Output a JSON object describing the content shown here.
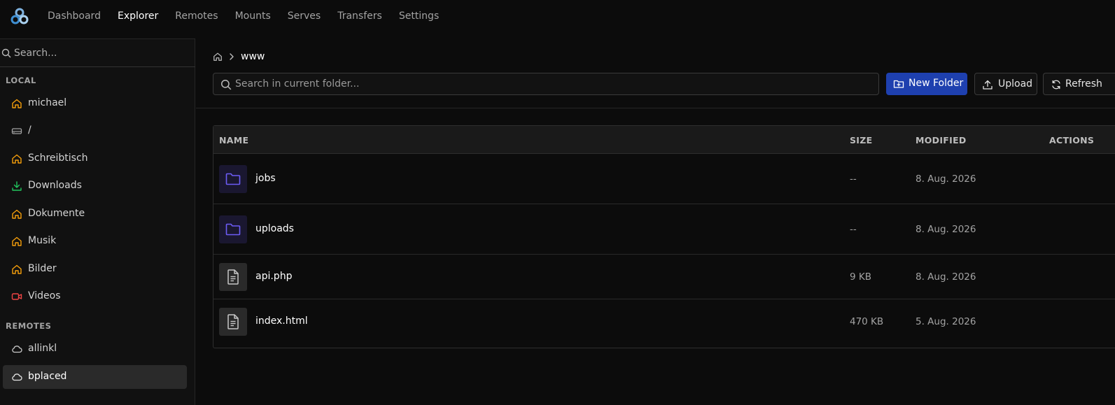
{
  "nav": {
    "items": [
      {
        "label": "Dashboard",
        "active": false
      },
      {
        "label": "Explorer",
        "active": true
      },
      {
        "label": "Remotes",
        "active": false
      },
      {
        "label": "Mounts",
        "active": false
      },
      {
        "label": "Serves",
        "active": false
      },
      {
        "label": "Transfers",
        "active": false
      },
      {
        "label": "Settings",
        "active": false
      }
    ]
  },
  "sidebar": {
    "search_placeholder": "Search...",
    "local_label": "LOCAL",
    "local_items": [
      {
        "label": "michael",
        "icon": "home-icon"
      },
      {
        "label": "/",
        "icon": "drive-icon"
      },
      {
        "label": "Schreibtisch",
        "icon": "home-icon"
      },
      {
        "label": "Downloads",
        "icon": "download-icon"
      },
      {
        "label": "Dokumente",
        "icon": "home-icon"
      },
      {
        "label": "Musik",
        "icon": "home-icon"
      },
      {
        "label": "Bilder",
        "icon": "home-icon"
      },
      {
        "label": "Videos",
        "icon": "video-icon"
      }
    ],
    "remotes_label": "REMOTES",
    "remote_items": [
      {
        "label": "allinkl",
        "icon": "cloud-icon",
        "selected": false
      },
      {
        "label": "bplaced",
        "icon": "cloud-icon",
        "selected": true
      }
    ]
  },
  "breadcrumb": {
    "current": "www"
  },
  "toolbar": {
    "search_placeholder": "Search in current folder...",
    "new_folder_label": "New Folder",
    "upload_label": "Upload",
    "refresh_label": "Refresh"
  },
  "table": {
    "headers": {
      "name": "NAME",
      "size": "SIZE",
      "modified": "MODIFIED",
      "actions": "ACTIONS"
    },
    "rows": [
      {
        "name": "jobs",
        "type": "folder",
        "size": "--",
        "modified": "8. Aug. 2026"
      },
      {
        "name": "uploads",
        "type": "folder",
        "size": "--",
        "modified": "8. Aug. 2026"
      },
      {
        "name": "api.php",
        "type": "file",
        "size": "9 KB",
        "modified": "8. Aug. 2026"
      },
      {
        "name": "index.html",
        "type": "file",
        "size": "470 KB",
        "modified": "5. Aug. 2026"
      }
    ]
  },
  "colors": {
    "accent": "#1e40af",
    "home_icon": "#f59e0b",
    "download_icon": "#22c55e",
    "video_icon": "#ef4444",
    "folder_icon": "#6d5cf6"
  }
}
